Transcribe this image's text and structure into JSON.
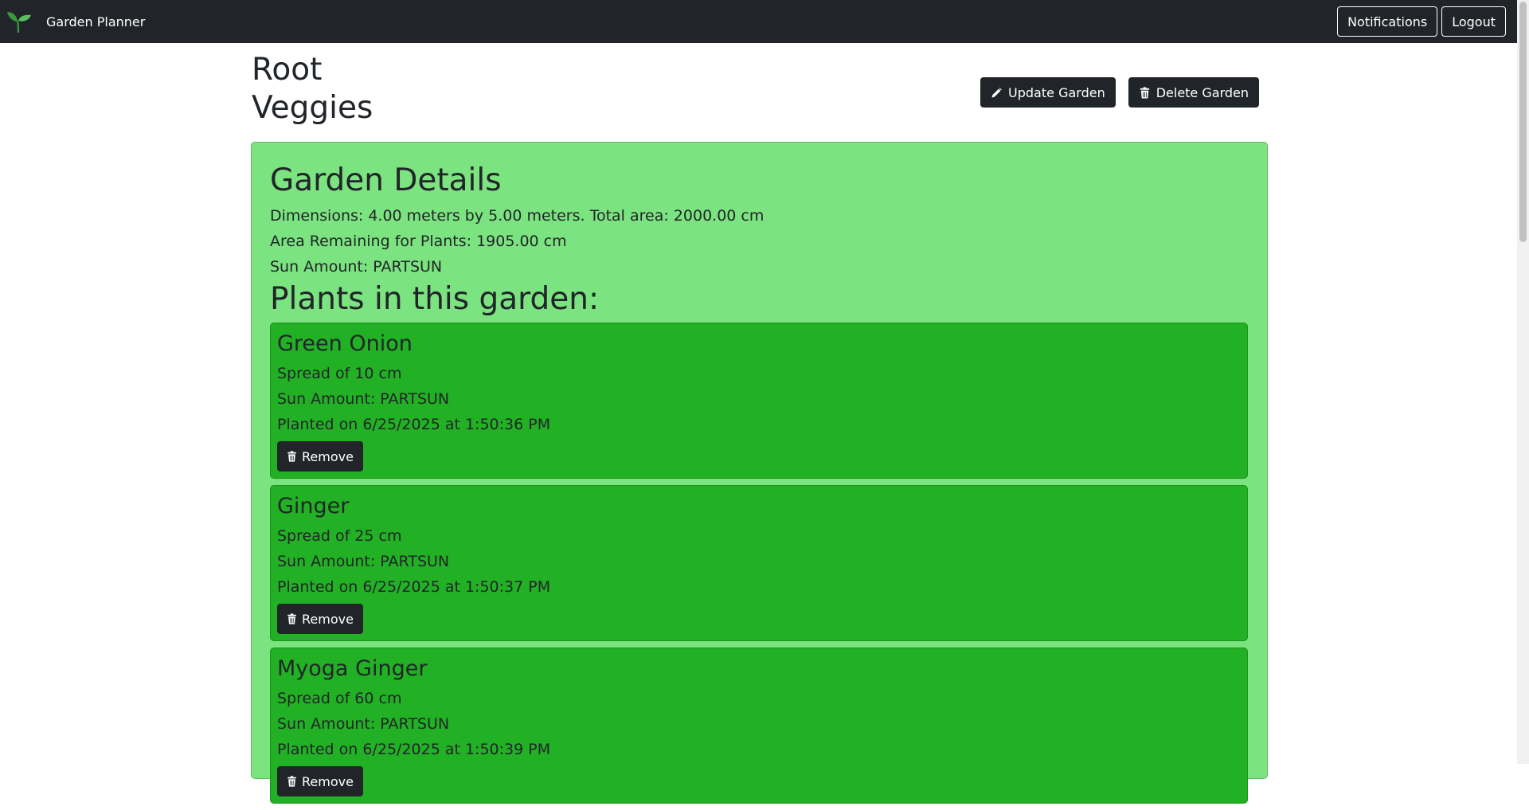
{
  "navbar": {
    "brand_text": "Garden Planner",
    "notifications_label": "Notifications",
    "logout_label": "Logout",
    "logo_icon": "sprout-icon"
  },
  "header": {
    "title": "Root Veggies",
    "update_label": "Update Garden",
    "delete_label": "Delete Garden"
  },
  "details": {
    "heading": "Garden Details",
    "dimensions": "Dimensions: 4.00 meters by 5.00 meters. Total area: 2000.00 cm",
    "area_remaining": "Area Remaining for Plants: 1905.00 cm",
    "sun_amount": "Sun Amount: PARTSUN",
    "plants_heading": "Plants in this garden:"
  },
  "plants": [
    {
      "name": "Green Onion",
      "spread": "Spread of 10 cm",
      "sun": "Sun Amount: PARTSUN",
      "planted": "Planted on 6/25/2025 at 1:50:36 PM",
      "remove_label": "Remove"
    },
    {
      "name": "Ginger",
      "spread": "Spread of 25 cm",
      "sun": "Sun Amount: PARTSUN",
      "planted": "Planted on 6/25/2025 at 1:50:37 PM",
      "remove_label": "Remove"
    },
    {
      "name": "Myoga Ginger",
      "spread": "Spread of 60 cm",
      "sun": "Sun Amount: PARTSUN",
      "planted": "Planted on 6/25/2025 at 1:50:39 PM",
      "remove_label": "Remove"
    }
  ],
  "colors": {
    "navbar_bg": "#212529",
    "details_bg": "#7be37f",
    "plant_bg": "#22b024"
  }
}
